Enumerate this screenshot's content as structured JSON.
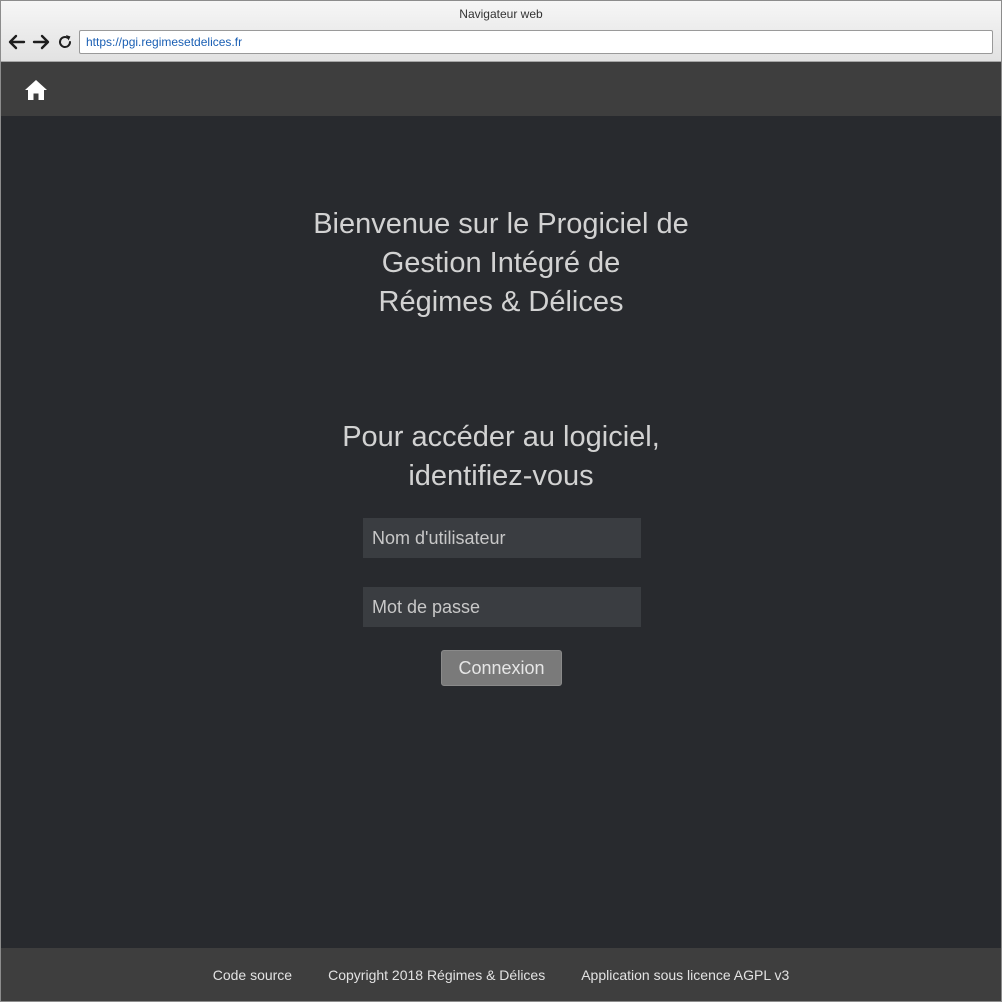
{
  "browser": {
    "title": "Navigateur web",
    "url": "https://pgi.regimesetdelices.fr"
  },
  "header": {
    "home_icon": "home-icon"
  },
  "main": {
    "welcome_lines": [
      "Bienvenue sur le Progiciel de",
      "Gestion Intégré de",
      "Régimes & Délices"
    ],
    "prompt_lines": [
      "Pour accéder au logiciel,",
      "identifiez-vous"
    ],
    "username_placeholder": "Nom d'utilisateur",
    "password_placeholder": "Mot de passe",
    "login_label": "Connexion"
  },
  "footer": {
    "source_link": "Code source",
    "copyright": "Copyright 2018 Régimes & Délices",
    "license": "Application sous licence AGPL v3"
  },
  "colors": {
    "background": "#282a2e",
    "bar": "#3e3e3e",
    "text": "#d2d2d2",
    "input_bg": "#3a3d41",
    "button_bg": "#7a7a7a",
    "url_text": "#1a5fb4"
  }
}
